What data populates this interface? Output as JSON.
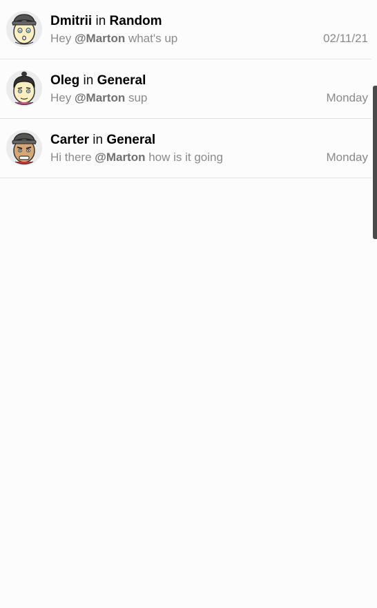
{
  "threads": [
    {
      "author": "Dmitrii",
      "in_word": "in",
      "channel": "Random",
      "preview_before": "Hey ",
      "mention": "@Marton",
      "preview_after": " what's up",
      "time": "02/11/21",
      "avatar_icon": "avatar-dmitrii-icon"
    },
    {
      "author": "Oleg",
      "in_word": "in",
      "channel": "General",
      "preview_before": "Hey ",
      "mention": "@Marton",
      "preview_after": " sup",
      "time": "Monday",
      "avatar_icon": "avatar-oleg-icon"
    },
    {
      "author": "Carter",
      "in_word": "in",
      "channel": "General",
      "preview_before": "Hi there ",
      "mention": "@Marton",
      "preview_after": " how is it going",
      "time": "Monday",
      "avatar_icon": "avatar-carter-icon"
    }
  ],
  "colors": {
    "background": "#fcfcfc",
    "divider": "#e2e2e2",
    "muted_text": "#8a8a8a"
  }
}
